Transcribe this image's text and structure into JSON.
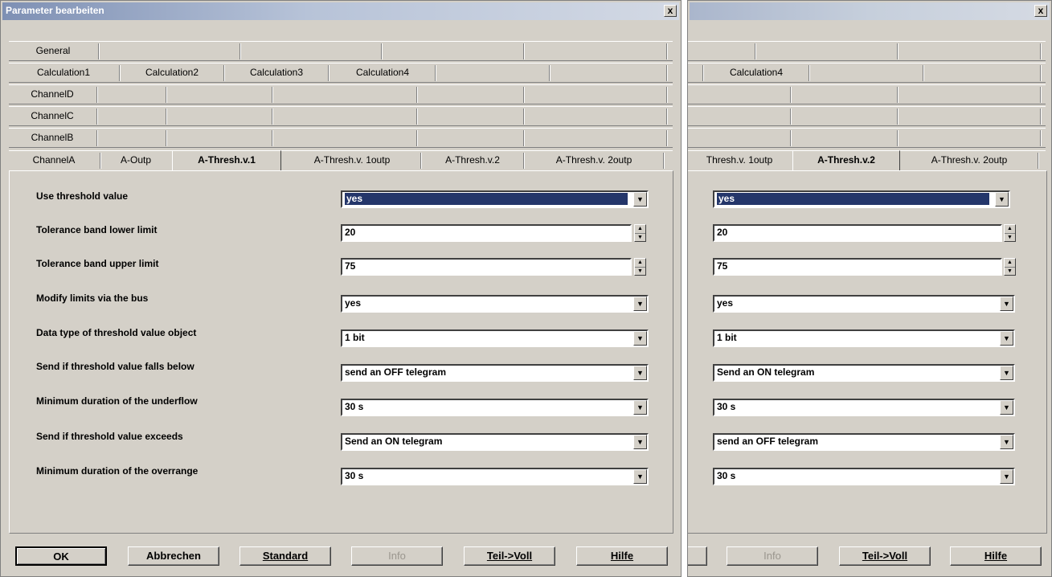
{
  "dialog": {
    "title": "Parameter bearbeiten",
    "close_glyph": "x"
  },
  "tabs": {
    "row1": [
      "General"
    ],
    "row2": [
      "Calculation1",
      "Calculation2",
      "Calculation3",
      "Calculation4"
    ],
    "row3": [
      "ChannelD"
    ],
    "row4": [
      "ChannelC"
    ],
    "row5": [
      "ChannelB"
    ],
    "row6": [
      "ChannelA",
      "A-Outp",
      "A-Thresh.v.1",
      "A-Thresh.v. 1outp",
      "A-Thresh.v.2",
      "A-Thresh.v. 2outp"
    ]
  },
  "right_tabs": {
    "row2": [
      "Calculation4"
    ],
    "row6": [
      "Thresh.v. 1outp",
      "A-Thresh.v.2",
      "A-Thresh.v. 2outp"
    ]
  },
  "params": {
    "labels": [
      "Use threshold value",
      "Tolerance band lower limit",
      "Tolerance band upper limit",
      "Modify limits via the bus",
      "Data type of threshold value object",
      "Send if threshold value falls below",
      "Minimum duration of the underflow",
      "Send if threshold value exceeds",
      "Minimum duration of the overrange"
    ],
    "left_values": [
      "yes",
      "20",
      "75",
      "yes",
      "1 bit",
      "send an OFF telegram",
      "30 s",
      "Send an ON telegram",
      "30 s"
    ],
    "right_values": [
      "yes",
      "20",
      "75",
      "yes",
      "1 bit",
      "Send an ON telegram",
      "30 s",
      "send an OFF telegram",
      "30 s"
    ]
  },
  "buttons": {
    "ok": "OK",
    "cancel": "Abbrechen",
    "standard": "Standard",
    "info": "Info",
    "partial_full": "Teil->Voll",
    "help": "Hilfe"
  },
  "icons": {
    "dropdown": "chevron-down-icon",
    "spinner": "up-down-arrows-icon",
    "close": "close-icon"
  }
}
